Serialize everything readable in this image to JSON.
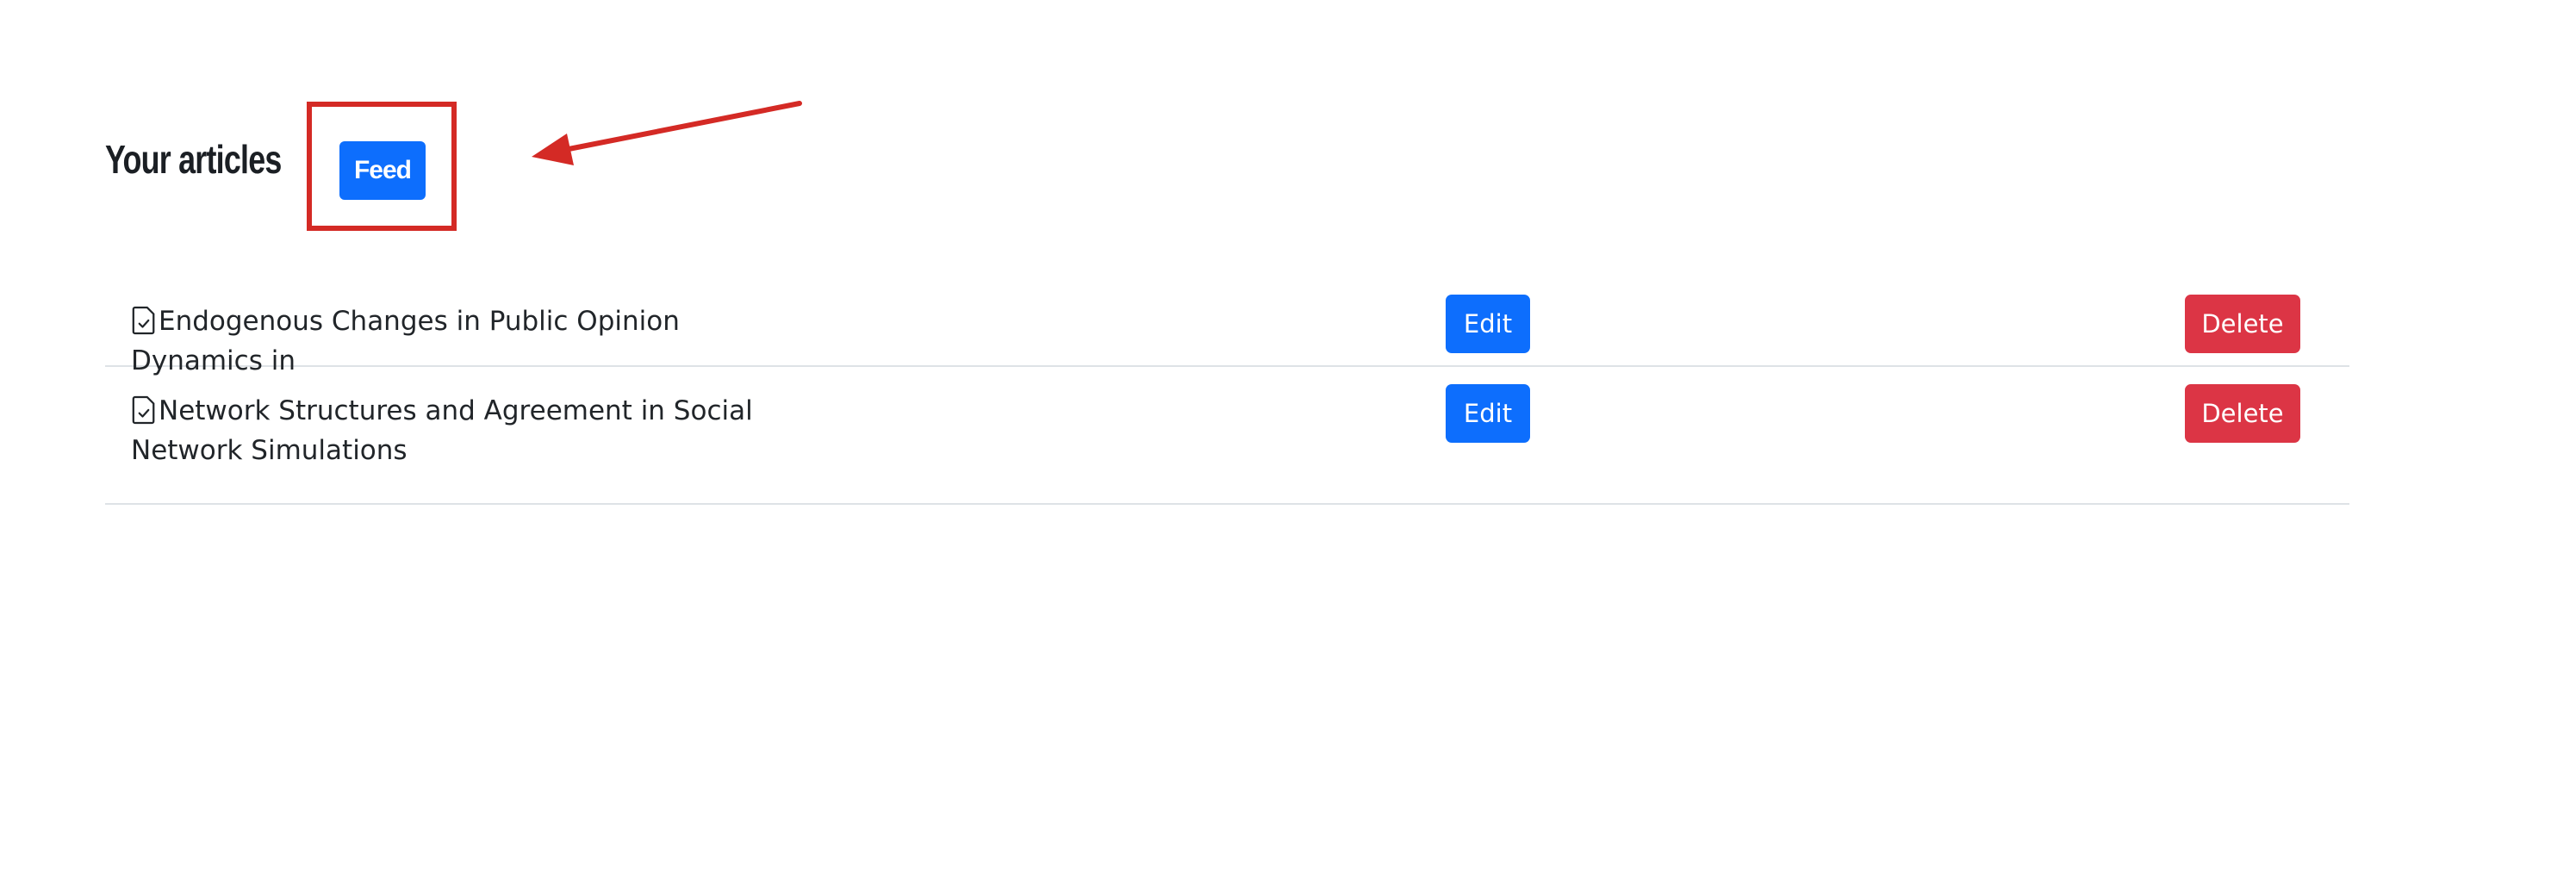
{
  "header": {
    "title": "Your articles",
    "feed_label": "Feed"
  },
  "annotation": {
    "color": "#d42a25"
  },
  "articles": [
    {
      "title": "Endogenous Changes in Public Opinion Dynamics in",
      "icon": "file-check-icon",
      "edit_label": "Edit",
      "delete_label": "Delete"
    },
    {
      "title": "Network Structures and Agreement in Social Network Simulations",
      "icon": "file-check-icon",
      "edit_label": "Edit",
      "delete_label": "Delete"
    }
  ],
  "colors": {
    "primary": "#0d6efd",
    "danger": "#dc3545",
    "divider": "#dee2e6"
  }
}
